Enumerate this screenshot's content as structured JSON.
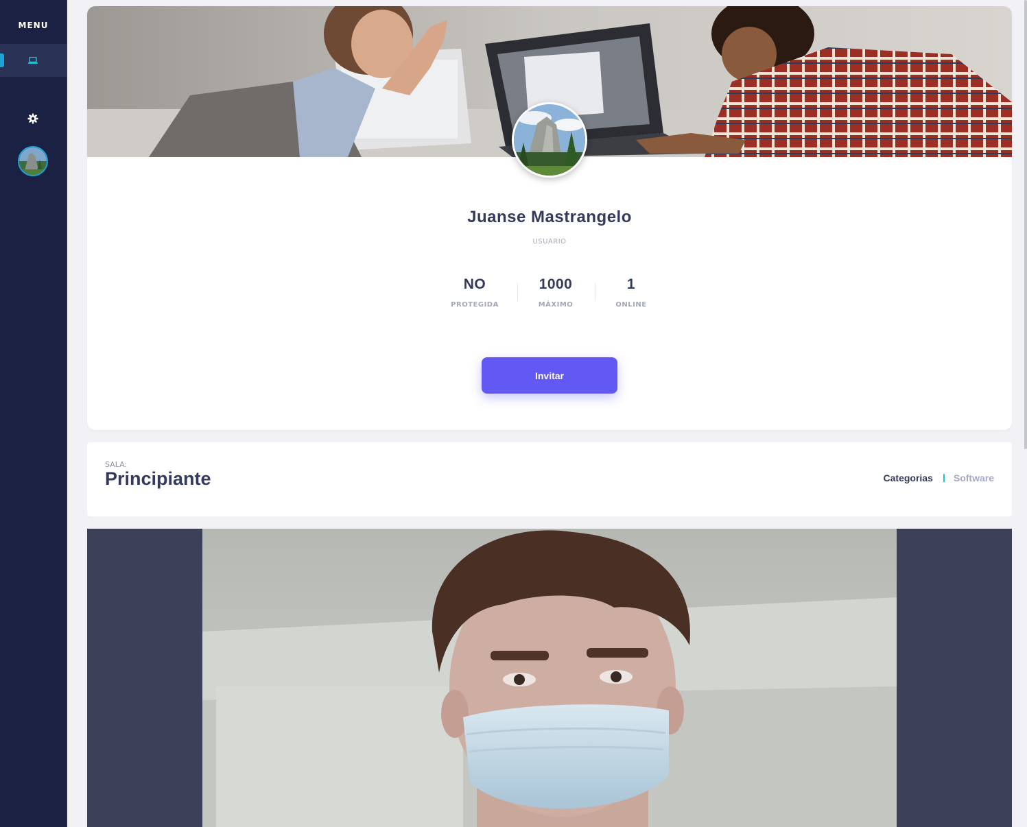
{
  "sidebar": {
    "menu_title": "MENU",
    "items": [
      {
        "name": "laptop-icon",
        "active": true
      },
      {
        "name": "gear-icon",
        "active": false
      }
    ],
    "accent_color": "#1fa2d8"
  },
  "profile": {
    "name": "Juanse Mastrangelo",
    "role": "USUARIO",
    "stats": [
      {
        "value": "NO",
        "label": "PROTEGIDA"
      },
      {
        "value": "1000",
        "label": "MÁXIMO"
      },
      {
        "value": "1",
        "label": "ONLINE"
      }
    ],
    "invite_label": "Invitar",
    "button_color": "#6259f4"
  },
  "room": {
    "label": "SALA:",
    "title": "Principiante",
    "breadcrumb": {
      "category": "Categorias",
      "current": "Software"
    }
  }
}
